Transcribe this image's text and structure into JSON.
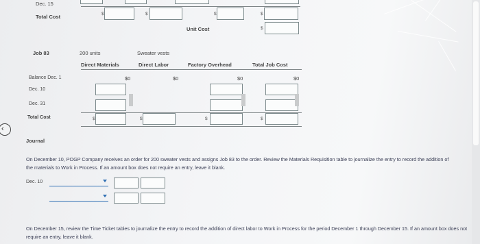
{
  "top": {
    "dec15_label": "Dec. 15",
    "total_cost_label": "Total Cost",
    "unit_cost_label": "Unit Cost",
    "currency": "$"
  },
  "job": {
    "job_label": "Job 83",
    "units": "200 units",
    "product": "Sweater vests",
    "columns": [
      "Direct Materials",
      "Direct Labor",
      "Factory Overhead",
      "Total Job Cost"
    ],
    "balance_label": "Balance Dec. 1",
    "balance_values": [
      "$0",
      "$0",
      "$0",
      "$0"
    ],
    "row_dec10": "Dec. 10",
    "row_dec31": "Dec. 31",
    "total_cost_label": "Total Cost",
    "currency": "$"
  },
  "journal": {
    "heading": "Journal",
    "instruction1": "On December 10, POGP Company receives an order for 200 sweater vests and assigns Job 83 to the order. Review the Materials Requisition table to journalize the entry to record the addition of the materials to Work in Process. If an amount box does not require an entry, leave it blank.",
    "entry_date": "Dec. 10",
    "instruction2": "On December 15, review the Time Ticket tables to journalize the entry to record the addition of direct labor to Work in Process for the period December 1 through December 15. If an amount box does not require an entry, leave it blank."
  },
  "icons": {
    "back": "chevron-left-icon",
    "dropdown": "caret-down-icon"
  }
}
